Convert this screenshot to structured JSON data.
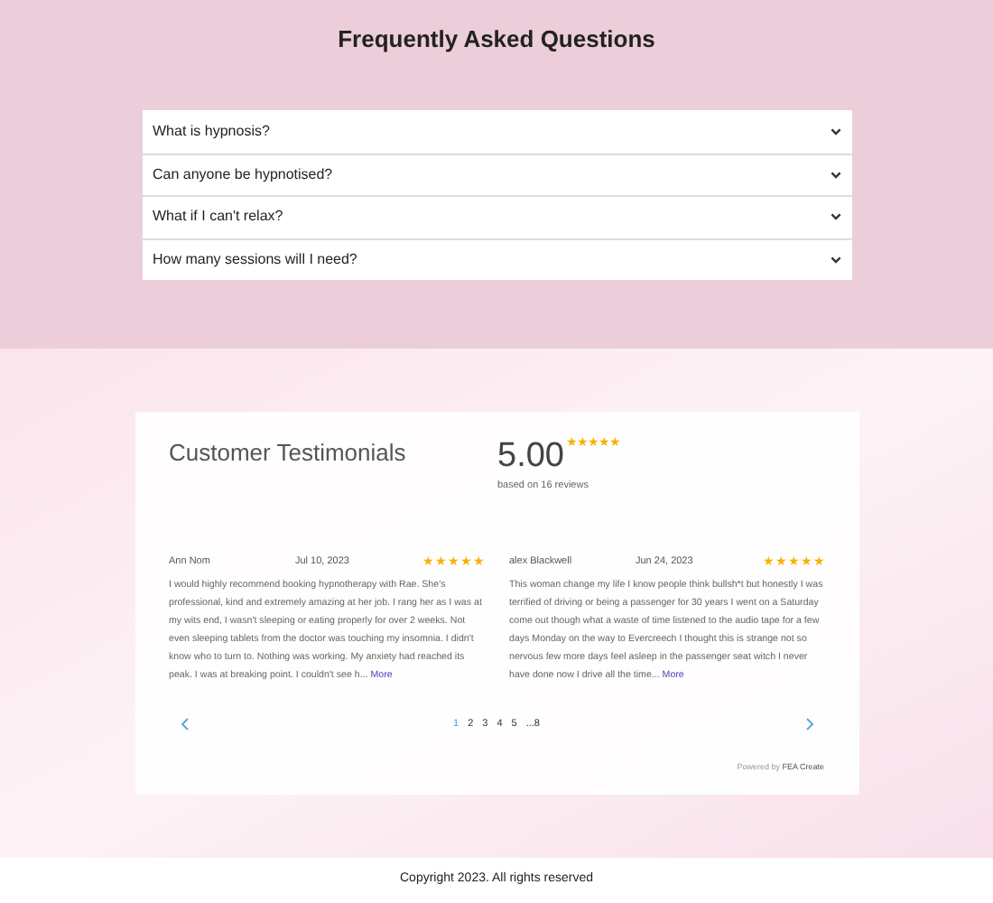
{
  "faq": {
    "title": "Frequently Asked Questions",
    "items": [
      {
        "question": "What is hypnosis?",
        "expanded": false
      },
      {
        "question": "Can anyone be hypnotised?",
        "expanded": false
      },
      {
        "question": "What if I can't relax?",
        "expanded": false
      },
      {
        "question": "How many sessions will I need?",
        "expanded": false
      }
    ]
  },
  "testimonials": {
    "title": "Customer Testimonials",
    "rating": "5.00",
    "stars": 5,
    "based_on": "based on 16 reviews",
    "reviews": [
      {
        "author": "Ann Nom",
        "date": "Jul 10, 2023",
        "stars": 5,
        "text": "I would highly recommend booking hypnotherapy with Rae.  She's professional, kind and extremely amazing at her job. I rang her as I was at my wits end, I wasn't sleeping or eating properly for over 2 weeks.  Not even sleeping tablets from the doctor was touching my insomnia. I didn't know who to turn to.  Nothing was working. My anxiety had reached its peak.  I was at breaking point. I couldn't see h...",
        "more": "More"
      },
      {
        "author": "alex Blackwell",
        "date": "Jun 24, 2023",
        "stars": 5,
        "text": "This woman change my life I know people think bullsh*t but honestly I was terrified of driving or being a passenger for 30 years I went on a Saturday come out though what a waste of time listened to the audio tape for a few days Monday on the way to Evercreech I thought this is strange not so nervous few more days feel asleep in the passenger seat witch I never have done now I drive all the time...",
        "more": "More"
      }
    ],
    "pages": [
      {
        "label": "1",
        "selected": true
      },
      {
        "label": "2",
        "selected": false
      },
      {
        "label": "3",
        "selected": false
      },
      {
        "label": "4",
        "selected": false
      },
      {
        "label": "5",
        "selected": false
      },
      {
        "label": "...8",
        "selected": false
      }
    ],
    "powered_by": "Powered by",
    "powered_brand": "FEA Create"
  },
  "footer": "Copyright 2023. All rights reserved"
}
